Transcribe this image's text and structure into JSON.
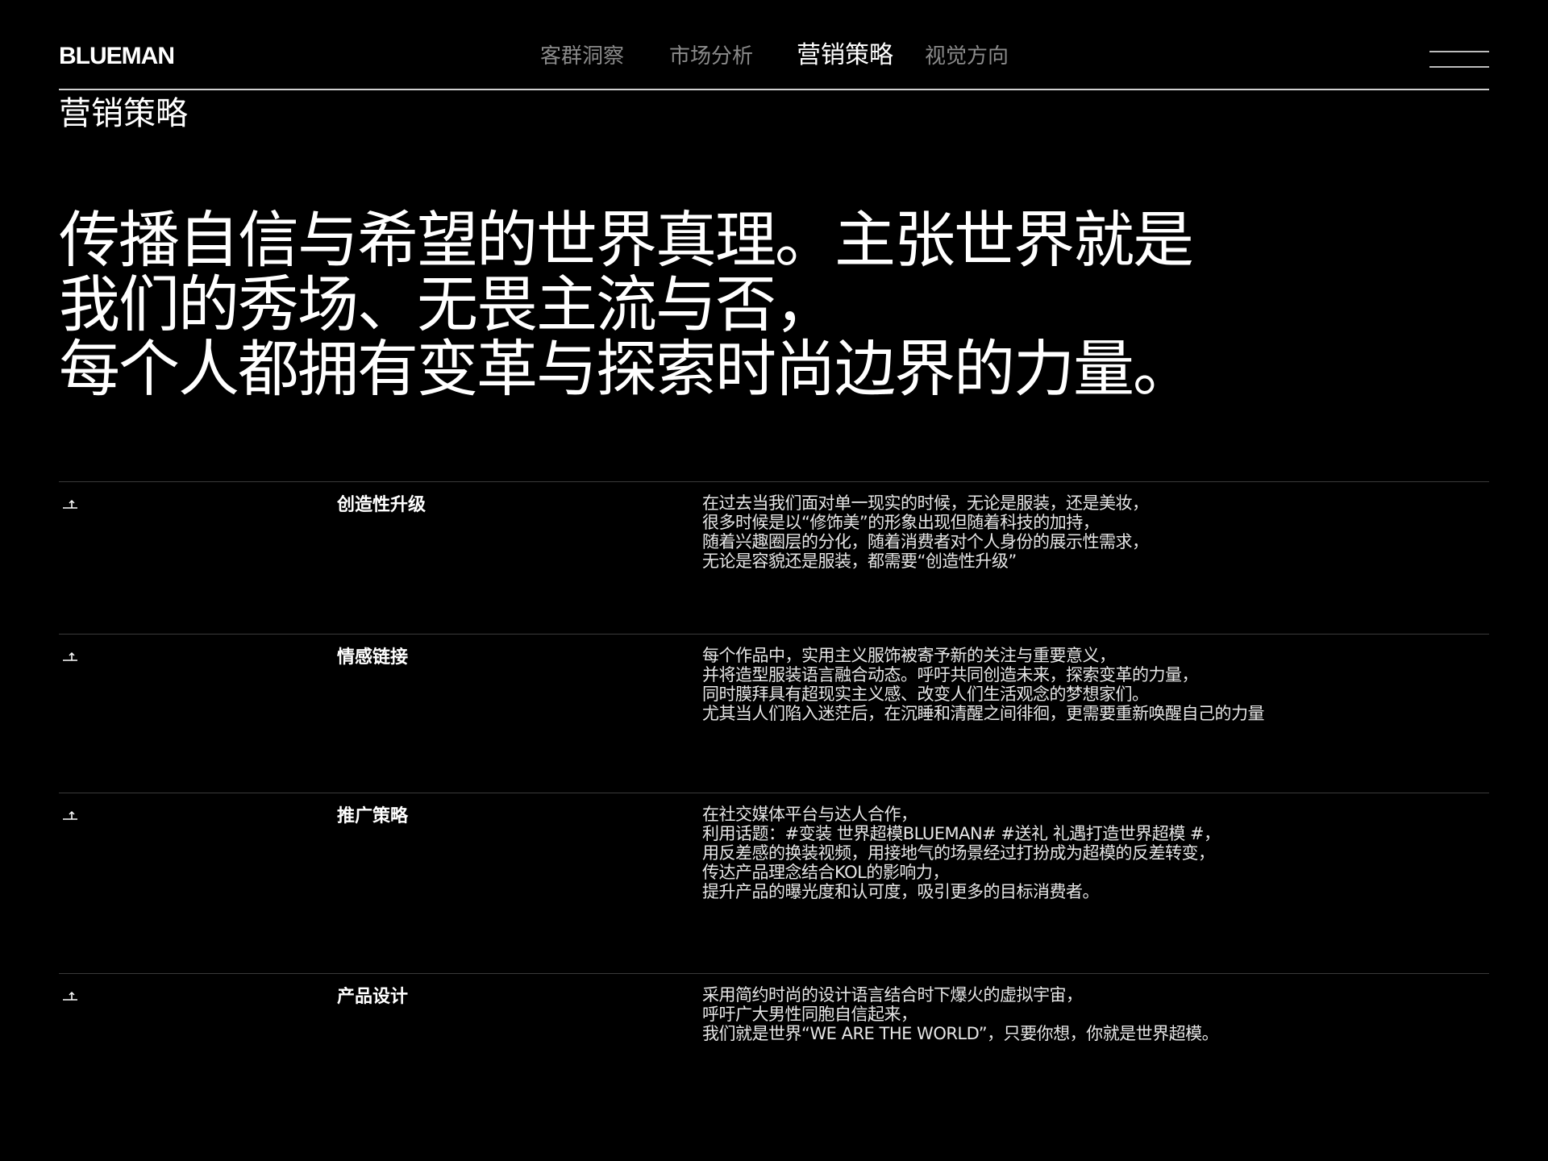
{
  "header": {
    "logo": "BLUEMAN",
    "nav": [
      {
        "label": "客群洞察"
      },
      {
        "label": "市场分析"
      },
      {
        "label": "营销策略"
      },
      {
        "label": "视觉方向"
      }
    ],
    "menu_icon": "hamburger-menu-icon"
  },
  "section_title": "营销策略",
  "headline": {
    "lines": [
      "传播自信与希望的世界真理。主张世界就是",
      "我们的秀场、无畏主流与否，",
      "每个人都拥有变革与探索时尚边界的力量。"
    ]
  },
  "rows": [
    {
      "icon": "corner-arrow-icon",
      "title": "创造性升级",
      "desc": [
        "在过去当我们面对单一现实的时候，无论是服装，还是美妆，",
        "很多时候是以“修饰美”的形象出现但随着科技的加持，",
        "随着兴趣圈层的分化，随着消费者对个人身份的展示性需求，",
        "无论是容貌还是服装，都需要“创造性升级”"
      ]
    },
    {
      "icon": "corner-arrow-icon",
      "title": "情感链接",
      "desc": [
        "每个作品中，实用主义服饰被寄予新的关注与重要意义，",
        "并将造型服装语言融合动态。呼吁共同创造未来，探索变革的力量，",
        "同时膜拜具有超现实主义感、改变人们生活观念的梦想家们。",
        "尤其当人们陷入迷茫后，在沉睡和清醒之间徘徊，更需要重新唤醒自己的力量"
      ]
    },
    {
      "icon": "corner-arrow-icon",
      "title": "推广策略",
      "desc": [
        "在社交媒体平台与达人合作，",
        "利用话题：#变装 世界超模BLUEMAN# #送礼 礼遇打造世界超模 #，",
        "用反差感的换装视频，用接地气的场景经过打扮成为超模的反差转变，",
        "传达产品理念结合KOL的影响力，",
        "提升产品的曝光度和认可度，吸引更多的目标消费者。"
      ]
    },
    {
      "icon": "corner-arrow-icon",
      "title": "产品设计",
      "desc": [
        "采用简约时尚的设计语言结合时下爆火的虚拟宇宙，",
        "呼吁广大男性同胞自信起来，",
        "我们就是世界“WE ARE THE WORLD”，只要你想，你就是世界超模。"
      ]
    }
  ]
}
